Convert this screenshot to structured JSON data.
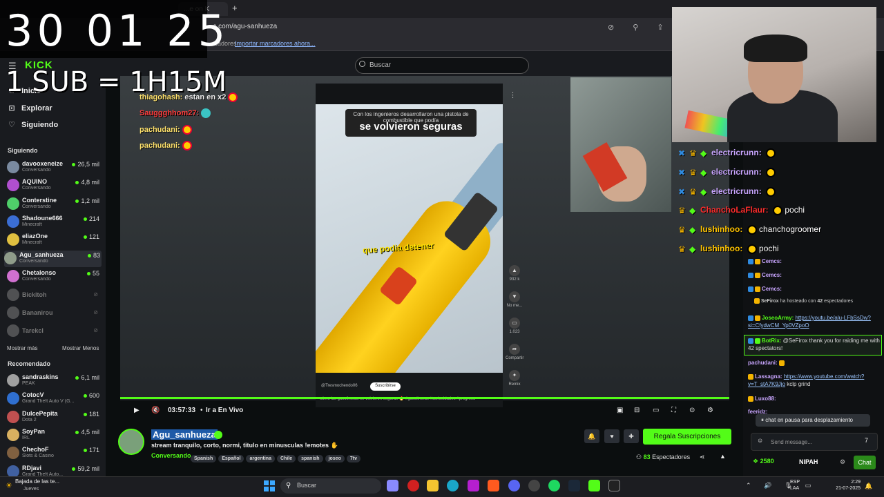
{
  "timer": {
    "value": "30 01 25",
    "sub_rule": "1 SUB = 1H15M"
  },
  "browser": {
    "tab_label": "...e on K",
    "url": "...c.com/agu-sanhueza",
    "bookmarks_label": "...rcadores",
    "import_bookmarks": "Importar marcadores ahora..."
  },
  "kick": {
    "logo": "KICK",
    "search_placeholder": "Buscar"
  },
  "sidebar": {
    "nav": [
      {
        "label": "Inicio",
        "icon": "home-icon"
      },
      {
        "label": "Explorar",
        "icon": "compass-icon"
      },
      {
        "label": "Siguiendo",
        "icon": "heart-icon"
      }
    ],
    "following_title": "Siguiendo",
    "following": [
      {
        "name": "davooxeneize",
        "sub": "Conversando",
        "count": "26,5 mil",
        "color": "#7a8aa0"
      },
      {
        "name": "AQUINO",
        "sub": "Conversando",
        "count": "4,8 mil",
        "color": "#b04fcf"
      },
      {
        "name": "Conterstine",
        "sub": "Conversando",
        "count": "1,2 mil",
        "color": "#4fcf6a"
      },
      {
        "name": "Shadoune666",
        "sub": "Minecraft",
        "count": "214",
        "color": "#3b6ed4"
      },
      {
        "name": "eliazOne",
        "sub": "Minecraft",
        "count": "121",
        "color": "#e0c040"
      },
      {
        "name": "Agu_sanhueza",
        "sub": "Conversando",
        "count": "83",
        "color": "#8f9c8a"
      },
      {
        "name": "Chetalonso",
        "sub": "Conversando",
        "count": "55",
        "color": "#d070d0"
      }
    ],
    "offline": [
      "Bickitoh",
      "Bananirou",
      "Tarekcl"
    ],
    "show_more": "Mostrar más",
    "show_less": "Mostrar Menos",
    "recommended_title": "Recomendado",
    "recommended": [
      {
        "name": "sandraskins",
        "sub": "PEAK",
        "count": "6,1 mil",
        "color": "#a0a0a0"
      },
      {
        "name": "CotocV",
        "sub": "Grand Theft Auto V (G...",
        "count": "600",
        "color": "#2f6fd0"
      },
      {
        "name": "DulcePepita",
        "sub": "Dota 2",
        "count": "181",
        "color": "#c05050"
      },
      {
        "name": "SoyPan",
        "sub": "IRL",
        "count": "4,5 mil",
        "color": "#d8b060"
      },
      {
        "name": "ChechoF",
        "sub": "Slots & Casino",
        "count": "171",
        "color": "#806040"
      },
      {
        "name": "RDjavi",
        "sub": "Grand Theft Auto...",
        "count": "59,2 mil",
        "color": "#4060a0"
      }
    ]
  },
  "overlay_chat": [
    {
      "user": "thiagohash:",
      "text": "estan en x2"
    },
    {
      "user": "Sauggghhom27:",
      "text": ""
    },
    {
      "user": "pachudani:",
      "text": ""
    },
    {
      "user": "pachudani:",
      "text": ""
    }
  ],
  "inner_video": {
    "caption_small": "Con los ingenieros desarrollaron una pistola de combustible que podía",
    "caption_big": "se volvieron seguras",
    "caption_yellow": "que podia detener",
    "channel": "@Tresmochendo06",
    "subscribe": "Suscribirse",
    "desc": "cómo las gasolineras se volvieron seguras 🔥 #gasolineras #curiosidades #progreso",
    "likes": "932 k",
    "dislike": "No me...",
    "comments": "1.023",
    "share": "Compartir",
    "remix": "Remix"
  },
  "player": {
    "time": "03:57:33",
    "live_label": "Ir a En Vivo"
  },
  "stream": {
    "channel": "Agu_sanhueza",
    "title": "stream tranquilo, corto, normi, titulo en minusculas !emotes ✋",
    "category": "Conversando",
    "tags": [
      "Spanish",
      "Español",
      "argentina",
      "Chile",
      "spanish",
      "joseo",
      "7tv"
    ],
    "subs_button": "Regala Suscripciones",
    "viewers": "83",
    "viewers_label": "Espectadores"
  },
  "big_chat": [
    {
      "user": "electricrunn:",
      "text": ""
    },
    {
      "user": "electricrunn:",
      "text": ""
    },
    {
      "user": "electricrunn:",
      "text": ""
    },
    {
      "user": "ChanchoLaFlaur:",
      "text": "pochi"
    },
    {
      "user": "lushinhoo:",
      "text": "chanchogroomer"
    },
    {
      "user": "lushinhoo:",
      "text": "pochi"
    }
  ],
  "chat": {
    "messages": [
      {
        "user": "Cemcs:",
        "text": ""
      },
      {
        "user": "Cemcs:",
        "text": ""
      }
    ],
    "host_user": "SeFirox",
    "host_mid": "ha hosteado con",
    "host_count": "42",
    "host_end": "espectadores",
    "joseo_user": "JoseoArmy:",
    "joseo_link": "https://youtu.be/alu-LFbSsDw?si=Cfydw­CM_Yp0VZpoO",
    "botrix_user": "BotRix:",
    "botrix_text": "@SeFirox thank you for raiding me with 42 spectators!",
    "pachu_user": "pachudani:",
    "lassagna_user": "Lassagna:",
    "lassagna_link": "https://www.youtube.com/watch?v=T_stA7K9Jjo",
    "lassagna_text": "kclp grind",
    "luxo_user": "Luxo88:",
    "feerid_user": "feeridz:",
    "pause": "chat en pausa para desplazamiento",
    "input_placeholder": "Send message...",
    "points": "2580",
    "emote_set": "NIPAH",
    "chat_button": "Chat"
  },
  "taskbar": {
    "weather": "Bajada de las te...",
    "weather_sub": "Jueves",
    "search": "Buscar",
    "lang1": "ESP",
    "lang2": "LAA",
    "time": "2:29",
    "date": "21-07-2025"
  }
}
